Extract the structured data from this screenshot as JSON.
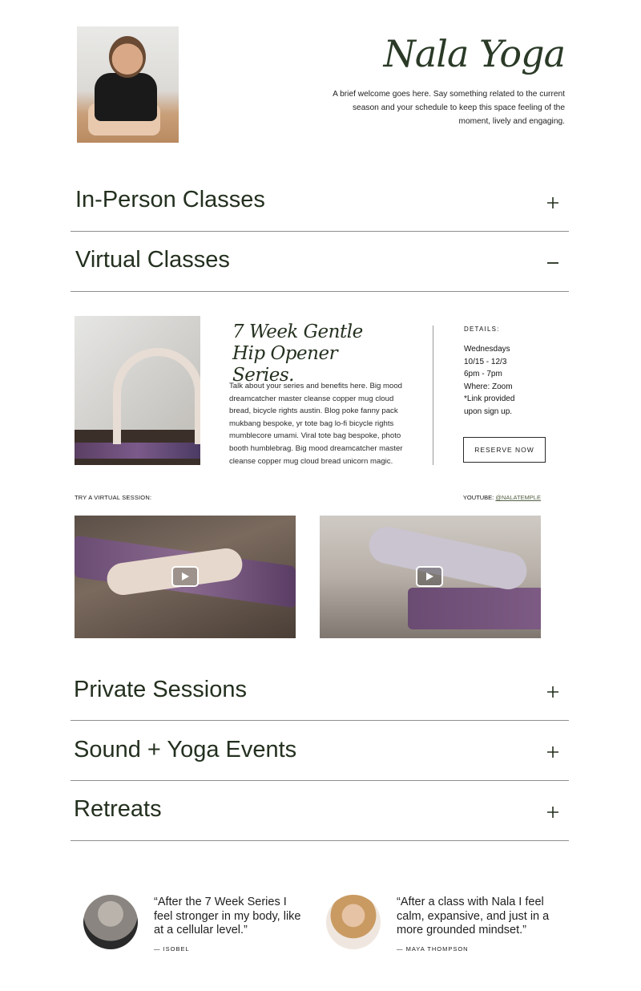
{
  "header": {
    "brand_title": "Nala Yoga",
    "welcome_text": "A brief welcome goes here. Say something related to the current season and your schedule to keep this space feeling of the moment, lively and engaging."
  },
  "accordions": [
    {
      "title": "In-Person Classes",
      "state": "collapsed",
      "icon": "plus-icon"
    },
    {
      "title": "Virtual Classes",
      "state": "expanded",
      "icon": "minus-icon"
    },
    {
      "title": "Private Sessions",
      "state": "collapsed",
      "icon": "plus-icon"
    },
    {
      "title": "Sound + Yoga Events",
      "state": "collapsed",
      "icon": "plus-icon"
    },
    {
      "title": "Retreats",
      "state": "collapsed",
      "icon": "plus-icon"
    }
  ],
  "virtual": {
    "series_title": "7 Week Gentle Hip Opener Series.",
    "description": "Talk about your series and benefits here.  Big mood dreamcatcher master cleanse copper mug cloud bread, bicycle rights austin. Blog poke fanny pack mukbang bespoke, yr tote bag lo-fi bicycle rights mumblecore umami. Viral tote bag bespoke, photo booth humblebrag. Big mood dreamcatcher master cleanse copper mug cloud bread unicorn magic.",
    "details_label": "DETAILS:",
    "details": [
      "Wednesdays",
      "10/15 - 12/3",
      "6pm - 7pm",
      "Where: Zoom",
      "*Link provided",
      "upon sign up."
    ],
    "reserve_label": "RESERVE NOW",
    "try_label": "TRY A VIRTUAL SESSION:",
    "youtube_label": "YOUTUBE:",
    "youtube_handle": "@NALATEMPLE"
  },
  "testimonials": [
    {
      "quote": "“After the 7 Week Series I feel stronger in my body, like at a cellular level.”",
      "author": "— ISOBEL"
    },
    {
      "quote": "“After a class with Nala I feel calm, expansive, and just in a more grounded mindset.”",
      "author": "— MAYA THOMPSON"
    }
  ],
  "colors": {
    "accent_green": "#24301f",
    "link_green": "#556246",
    "divider": "#8f8f8f"
  }
}
